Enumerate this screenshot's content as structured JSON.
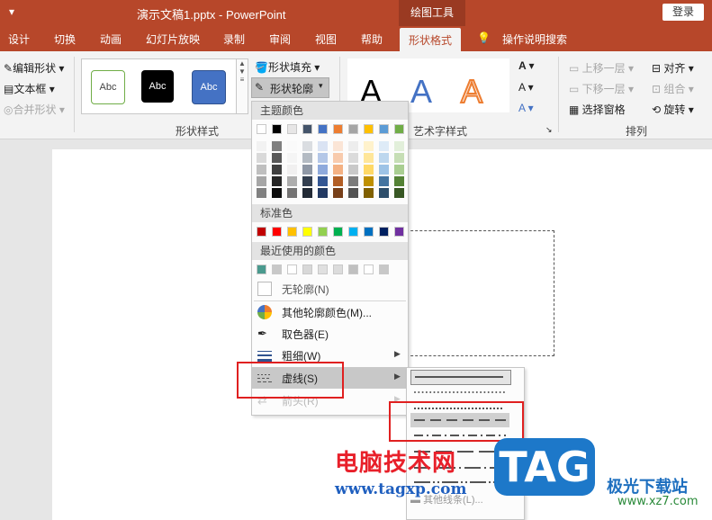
{
  "titlebar": {
    "qat_icon": "quick-access-dropdown",
    "doc_title": "演示文稿1.pptx",
    "separator": "-",
    "app_name": "PowerPoint",
    "context_group": "绘图工具",
    "login": "登录"
  },
  "tabs": [
    "设计",
    "切换",
    "动画",
    "幻灯片放映",
    "录制",
    "审阅",
    "视图",
    "帮助",
    "形状格式",
    "操作说明搜索"
  ],
  "ribbon": {
    "insert_shapes": [
      "编辑形状",
      "文本框",
      "合并形状"
    ],
    "shape_style_buttons": [
      "Abc",
      "Abc",
      "Abc"
    ],
    "shape_fill": "形状填充",
    "shape_outline": "形状轮廓",
    "group_shape_styles": "形状样式",
    "group_wordart": "艺术字样式",
    "wordart_letters": [
      "A",
      "A",
      "A"
    ],
    "arrange": [
      "上移一层",
      "下移一层",
      "选择窗格",
      "对齐",
      "组合",
      "旋转"
    ],
    "group_arrange": "排列"
  },
  "outline_menu": {
    "theme_colors_header": "主题颜色",
    "standard_colors_header": "标准色",
    "recent_colors_header": "最近使用的颜色",
    "no_outline": "无轮廓(N)",
    "more_colors": "其他轮廓颜色(M)...",
    "eyedropper": "取色器(E)",
    "weight": "粗细(W)",
    "dashes": "虚线(S)",
    "arrows": "箭头(R)",
    "theme_top_row": [
      "#ffffff",
      "#000000",
      "#e7e6e6",
      "#44546a",
      "#4472c4",
      "#ed7d31",
      "#a5a5a5",
      "#ffc000",
      "#5b9bd5",
      "#70ad47"
    ],
    "standard_colors": [
      "#c00000",
      "#ff0000",
      "#ffc000",
      "#ffff00",
      "#92d050",
      "#00b050",
      "#00b0f0",
      "#0070c0",
      "#002060",
      "#7030a0"
    ],
    "recent_colors": [
      "#4a9a8e",
      "#c8c8c8",
      "#ffffff",
      "#d8d8d8",
      "#e0e0e0",
      "#dcdcdc",
      "#c0c0c0",
      "#ffffff",
      "#c8c8c8"
    ]
  },
  "dash_submenu": {
    "more_lines": "其他线条(L)..."
  },
  "watermark": {
    "site_cn": "电脑技术网",
    "site_url": "www.tagxp.com",
    "tag": "TAG",
    "xz_cn": "极光下载站",
    "xz_url": "www.xz7.com"
  }
}
